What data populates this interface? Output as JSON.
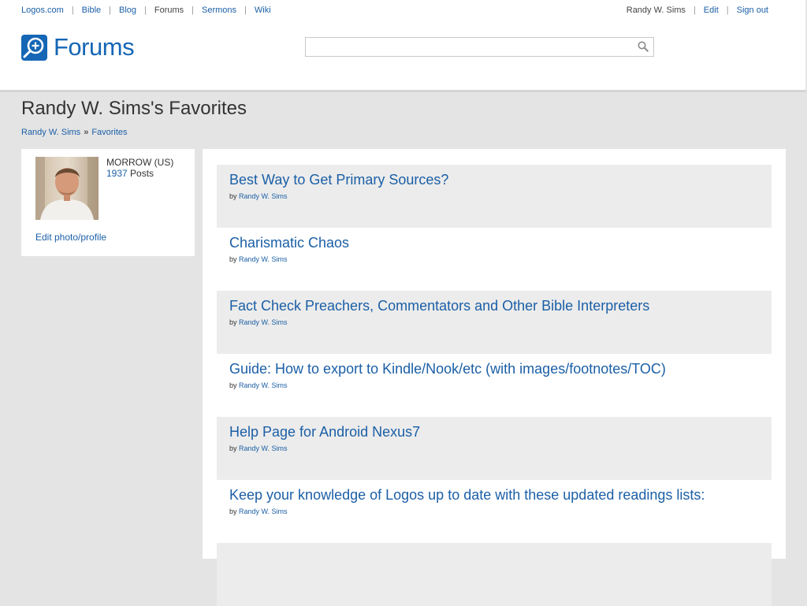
{
  "topnav": {
    "items": [
      "Logos.com",
      "Bible",
      "Blog",
      "Forums",
      "Sermons",
      "Wiki"
    ],
    "separator": "|"
  },
  "usernav": {
    "username": "Randy W. Sims",
    "edit": "Edit",
    "signout": "Sign out",
    "separator": "|"
  },
  "logo": {
    "text": "Forums",
    "icon": "magnifier-cross-icon",
    "color": "#1566b5"
  },
  "search": {
    "value": "",
    "placeholder": "",
    "icon": "search-icon"
  },
  "page": {
    "title": "Randy W. Sims's Favorites",
    "breadcrumb": {
      "user": "Randy W. Sims",
      "separator": "»",
      "current": "Favorites"
    }
  },
  "profile": {
    "avatar_icon": "user-photo",
    "location": "MORROW (US)",
    "post_count": "1937",
    "posts_label": "Posts",
    "edit_link": "Edit photo/profile"
  },
  "favorites": {
    "by_label": "by",
    "items": [
      {
        "title": "Best Way to Get Primary Sources?",
        "author": "Randy W. Sims"
      },
      {
        "title": "Charismatic Chaos",
        "author": "Randy W. Sims"
      },
      {
        "title": "Fact Check Preachers, Commentators and Other Bible Interpreters",
        "author": "Randy W. Sims"
      },
      {
        "title": "Guide: How to export to Kindle/Nook/etc (with images/footnotes/TOC)",
        "author": "Randy W. Sims"
      },
      {
        "title": "Help Page for Android Nexus7",
        "author": "Randy W. Sims"
      },
      {
        "title": "Keep your knowledge of Logos up to date with these updated readings lists:",
        "author": "Randy W. Sims"
      }
    ]
  },
  "colors": {
    "link": "#1b5fa6",
    "background": "#e4e4e4",
    "row_shade": "#ececec"
  }
}
